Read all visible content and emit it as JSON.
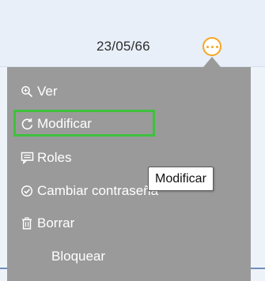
{
  "row": {
    "date": "23/05/66"
  },
  "icons": {
    "more": "more-horizontal-icon",
    "ver": "zoom-in-icon",
    "modificar": "refresh-icon",
    "roles": "message-icon",
    "cambiar": "check-circle-icon",
    "borrar": "trash-icon"
  },
  "menu": {
    "items": [
      {
        "label": "Ver"
      },
      {
        "label": "Modificar"
      },
      {
        "label": "Roles"
      },
      {
        "label": "Cambiar contraseña"
      },
      {
        "label": "Borrar"
      },
      {
        "label": "Bloquear"
      }
    ]
  },
  "tooltip": {
    "text": "Modificar"
  },
  "colors": {
    "menu_bg": "#9a9a9a",
    "accent": "#f5a623",
    "highlight": "#3ec13e"
  }
}
